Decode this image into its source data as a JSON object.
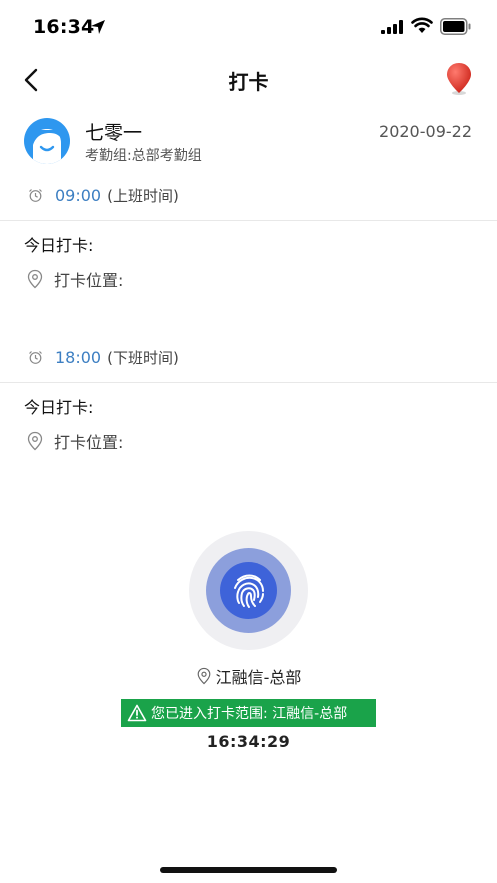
{
  "status_bar": {
    "time": "16:34",
    "icons": [
      "location-arrow-icon",
      "signal-icon",
      "wifi-icon",
      "battery-icon"
    ]
  },
  "nav": {
    "title": "打卡",
    "back_icon": "chevron-left-icon",
    "right_icon": "map-pin-icon",
    "pin_color": "#e23b2e"
  },
  "user": {
    "name": "七零一",
    "group": "考勤组:总部考勤组",
    "date": "2020-09-22",
    "avatar_color": "#2e97ef"
  },
  "sections": [
    {
      "time": "09:00",
      "tag": "(上班时间)",
      "today_label": "今日打卡:",
      "position_label": "打卡位置:"
    },
    {
      "time": "18:00",
      "tag": "(下班时间)",
      "today_label": "今日打卡:",
      "position_label": "打卡位置:"
    }
  ],
  "punch": {
    "location": "江融信-总部",
    "range_text": "您已进入打卡范围: 江融信-总部",
    "current_time": "16:34:29",
    "badge_color": "#1aa34a",
    "button_color": "#3e63d9"
  }
}
